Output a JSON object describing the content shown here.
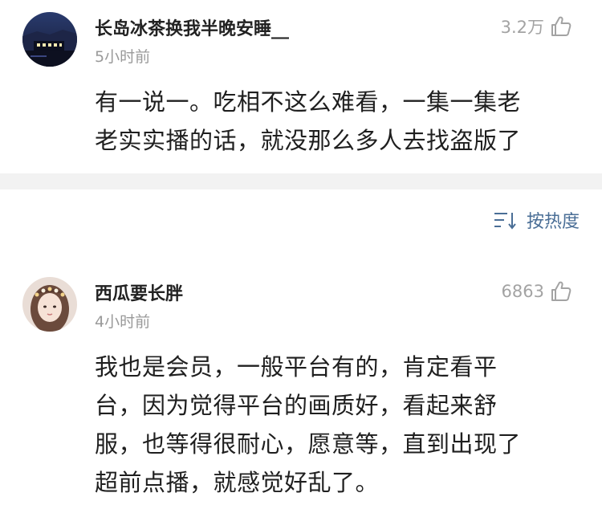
{
  "comments": [
    {
      "username": "长岛冰茶换我半晚安睡__",
      "time": "5小时前",
      "likes": "3.2万",
      "avatar_icon": "night-building-avatar",
      "lines": [
        "有一说一。吃相不这么难看，一集一集老",
        "老实实播的话，就没那么多人去找盗版了"
      ]
    },
    {
      "username": "西瓜要长胖",
      "time": "4小时前",
      "likes": "6863",
      "avatar_icon": "girl-portrait-avatar",
      "lines": [
        "我也是会员，一般平台有的，肯定看平",
        "台，因为觉得平台的画质好，看起来舒",
        "服，也等得很耐心，愿意等，直到出现了",
        "超前点播，就感觉好乱了。"
      ]
    }
  ],
  "sort": {
    "label": "按热度",
    "icon": "sort-icon"
  },
  "colors": {
    "accent": "#4a6e96",
    "muted": "#9a9a9a",
    "divider": "#f2f2f2"
  },
  "icons": {
    "like": "thumbs-up-icon"
  }
}
